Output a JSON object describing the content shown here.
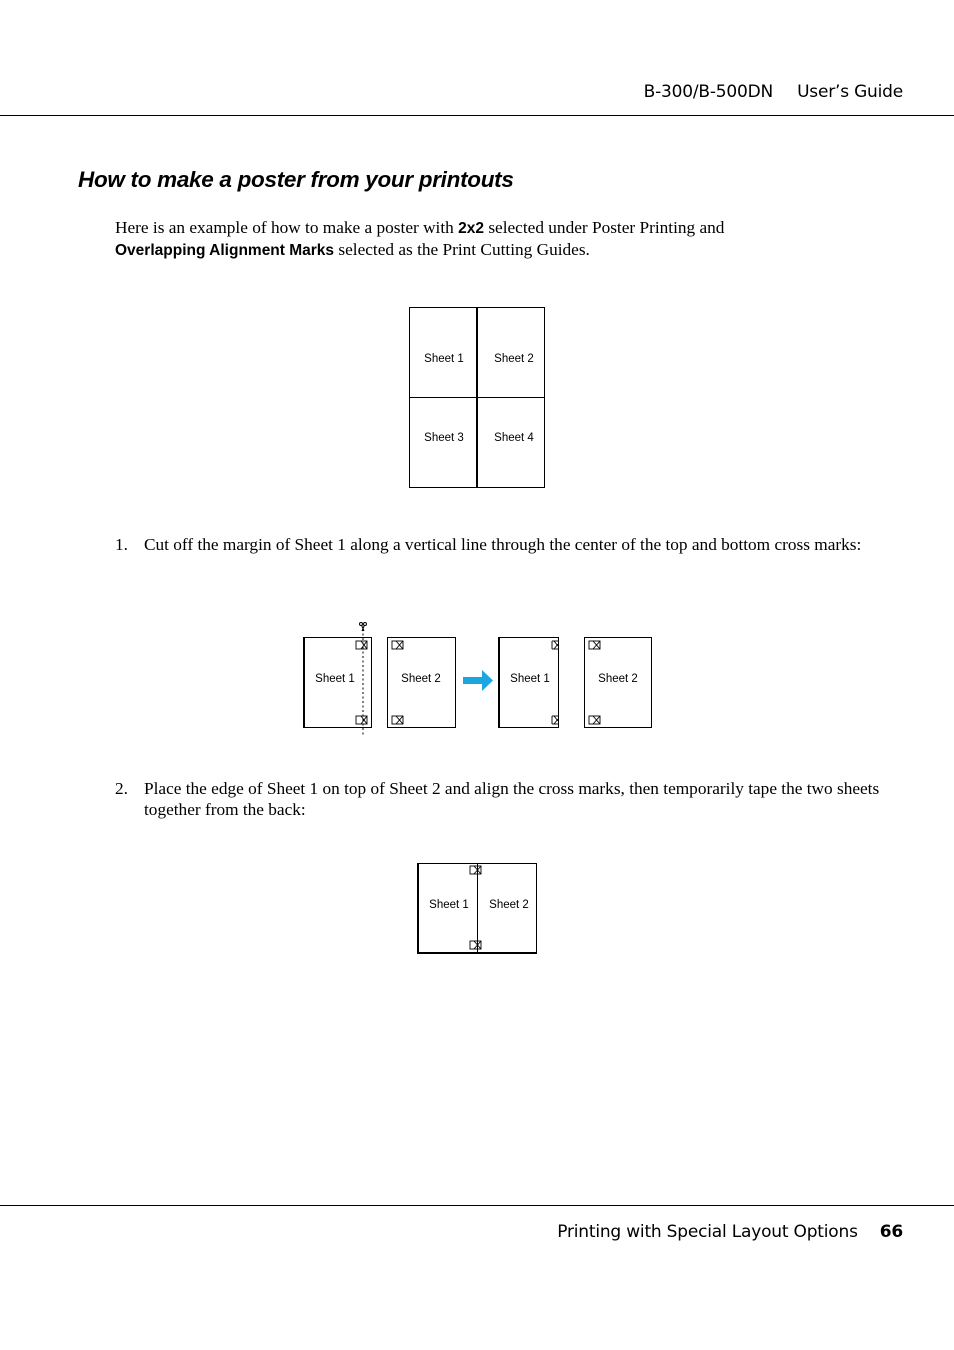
{
  "header": {
    "model": "B-300/B-500DN",
    "guide": "User’s Guide"
  },
  "section_title": "How to make a poster from your printouts",
  "intro": {
    "part1": "Here is an example of how to make a poster with ",
    "bold1": "2x2",
    "part2": " selected under Poster Printing and ",
    "bold2": "Overlapping Alignment Marks",
    "part3": " selected as the Print Cutting Guides."
  },
  "figure_grid": {
    "sheets": [
      "Sheet 1",
      "Sheet 2",
      "Sheet 3",
      "Sheet 4"
    ]
  },
  "steps": [
    {
      "number": "1.",
      "text": "Cut off the margin of Sheet 1 along a vertical line through the center of the top and bottom cross marks:"
    },
    {
      "number": "2.",
      "text": "Place the edge of Sheet 1 on top of Sheet 2 and align the cross marks, then temporarily tape the two sheets together from the back:"
    }
  ],
  "figure_cut": {
    "before": [
      "Sheet 1",
      "Sheet 2"
    ],
    "after": [
      "Sheet 1",
      "Sheet 2"
    ],
    "arrow_color": "#1BA6E0",
    "icons": [
      "scissors-icon",
      "arrow-right-icon",
      "cross-mark-icon"
    ]
  },
  "figure_join": {
    "sheets": [
      "Sheet 1",
      "Sheet 2"
    ]
  },
  "footer": {
    "section": "Printing with Special Layout Options",
    "page": "66"
  }
}
